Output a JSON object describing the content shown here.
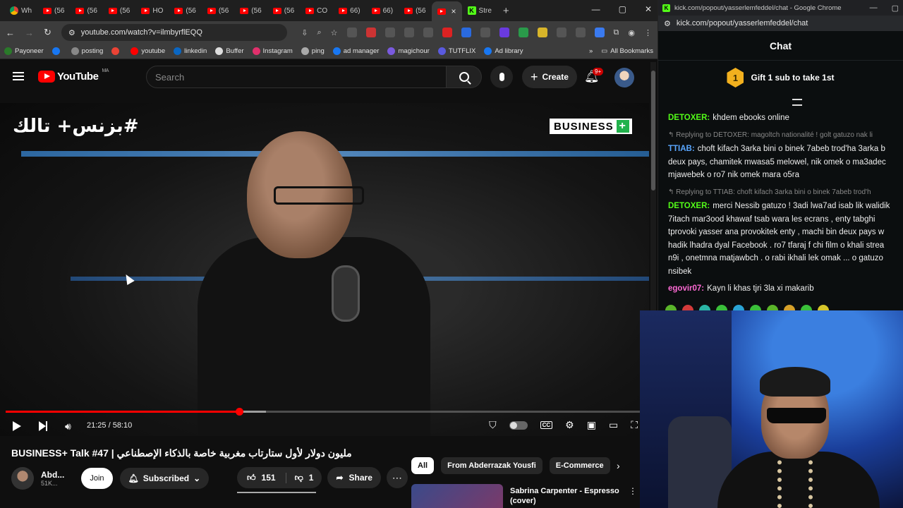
{
  "left_browser": {
    "tabs": [
      {
        "label": "Wh",
        "icon": "chrome-icon"
      },
      {
        "label": "(56",
        "icon": "youtube-icon"
      },
      {
        "label": "(56",
        "icon": "youtube-icon"
      },
      {
        "label": "(56",
        "icon": "youtube-icon"
      },
      {
        "label": "HO",
        "icon": "youtube-icon"
      },
      {
        "label": "(56",
        "icon": "youtube-icon"
      },
      {
        "label": "(56",
        "icon": "youtube-icon"
      },
      {
        "label": "(56",
        "icon": "youtube-icon"
      },
      {
        "label": "(56",
        "icon": "youtube-icon"
      },
      {
        "label": "CO",
        "icon": "youtube-icon"
      },
      {
        "label": "66)",
        "icon": "youtube-icon"
      },
      {
        "label": "66)",
        "icon": "youtube-icon"
      },
      {
        "label": "(56",
        "icon": "youtube-icon"
      },
      {
        "label": "",
        "icon": "youtube-icon",
        "active": true
      },
      {
        "label": "Stre",
        "icon": "kick-icon"
      }
    ],
    "url": "youtube.com/watch?v=ilmbyrflEQQ",
    "bookmarks": [
      "Payoneer",
      "",
      "posting",
      "",
      "youtube",
      "linkedin",
      "Buffer",
      "Instagram",
      "ping",
      "ad manager",
      "magichour",
      "TUTFLIX",
      "Ad library"
    ],
    "all_bookmarks": "All Bookmarks"
  },
  "youtube": {
    "logo": "YouTube",
    "region": "MA",
    "search_placeholder": "Search",
    "create_label": "Create",
    "notif_badge": "9+",
    "video": {
      "overlay_title": "#بزنس+ تالك",
      "brand_logo": "BUSINESS",
      "brand_plus": "+",
      "current_time": "21:25",
      "duration": "58:10",
      "time_display": "21:25 / 58:10",
      "progress_fraction": 0.368,
      "buffered_fraction": 0.41
    },
    "title": "BUSINESS+ Talk #47 | مليون دولار لأول ستارتاب مغربية خاصة بالذكاء الإصطناعي",
    "channel": {
      "name": "Abd...",
      "subs": "51K...",
      "join": "Join",
      "subscribed": "Subscribed"
    },
    "actions": {
      "likes": "151",
      "dislikes": "1",
      "share": "Share"
    },
    "chips": [
      "All",
      "From Abderrazak Yousfi",
      "E-Commerce"
    ],
    "recommendation": {
      "title": "Sabrina Carpenter - Espresso (cover)"
    }
  },
  "right_browser": {
    "window_title": "kick.com/popout/yasserlemfeddel/chat - Google Chrome",
    "url": "kick.com/popout/yasserlemfeddel/chat",
    "chat_title": "Chat",
    "gift_rank": "1",
    "gift_text": "Gift 1 sub to take 1st",
    "messages": [
      {
        "type": "msg",
        "user": "DETOXER:",
        "color": "#53fc18",
        "text": "khdem ebooks online"
      },
      {
        "type": "reply",
        "text": "Replying to DETOXER: magoltch nationalité ! golt gatuzo nak li"
      },
      {
        "type": "msg",
        "user": "TTIAB:",
        "color": "#5aa7ff",
        "text": "choft kifach 3arka bini o binek 7abeb trod'ha 3arka b"
      },
      {
        "type": "cont",
        "text": "deux pays, chamitek mwasa5 melowel, nik omek o ma3adec"
      },
      {
        "type": "cont",
        "text": "mjawebek o ro7 nik omek mara o5ra"
      },
      {
        "type": "reply",
        "text": "Replying to TTIAB: choft kifach 3arka bini o binek 7abeb trod'h"
      },
      {
        "type": "msg",
        "user": "DETOXER:",
        "color": "#53fc18",
        "text": "merci Nessib gatuzo ! 3adi lwa7ad isab lik walidik"
      },
      {
        "type": "cont",
        "text": "7itach mar3ood khawaf tsab wara les ecrans , enty tabghi"
      },
      {
        "type": "cont",
        "text": "tprovoki yasser ana provokitek enty , machi bin deux pays w"
      },
      {
        "type": "cont",
        "text": "hadik lhadra dyal Facebook . ro7 tfaraj f chi film o khali strea"
      },
      {
        "type": "cont",
        "text": "n9i , onetmna matjawbch . o rabi ikhali lek omak ... o gatuzo"
      },
      {
        "type": "cont",
        "text": "nsibek"
      },
      {
        "type": "msg",
        "user": "egovir07:",
        "color": "#ff6ad5",
        "text": "Kayn li khas tjri 3la xi makarib"
      }
    ]
  }
}
